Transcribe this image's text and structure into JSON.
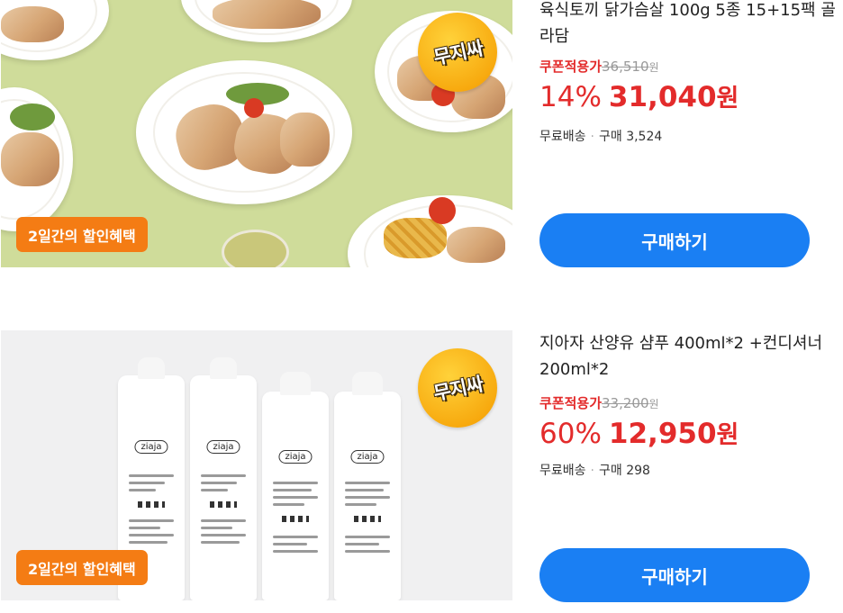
{
  "products": [
    {
      "title": "육식토끼 닭가슴살 100g 5종 15+15팩 골라담",
      "sticker": "무지싸",
      "promo_badge": "2일간의 할인혜택",
      "coupon_label": "쿠폰적용가",
      "original_price": "36,510",
      "original_unit": "원",
      "discount": "14%",
      "sale_price": "31,040",
      "sale_unit": "원",
      "shipping": "무료배송",
      "purchases": "구매 3,524",
      "buy_label": "구매하기"
    },
    {
      "title": "지아자 산양유 샴푸 400ml*2 +컨디셔너200ml*2",
      "sticker": "무지싸",
      "promo_badge": "2일간의 할인혜택",
      "coupon_label": "쿠폰적용가",
      "original_price": "33,200",
      "original_unit": "원",
      "discount": "60%",
      "sale_price": "12,950",
      "sale_unit": "원",
      "shipping": "무료배송",
      "purchases": "구매 298",
      "buy_label": "구매하기",
      "bottle_brand": "ziaja"
    }
  ],
  "colors": {
    "accent_red": "#e32b2b",
    "button_blue": "#1a7ff3",
    "badge_orange": "#f47c14"
  }
}
